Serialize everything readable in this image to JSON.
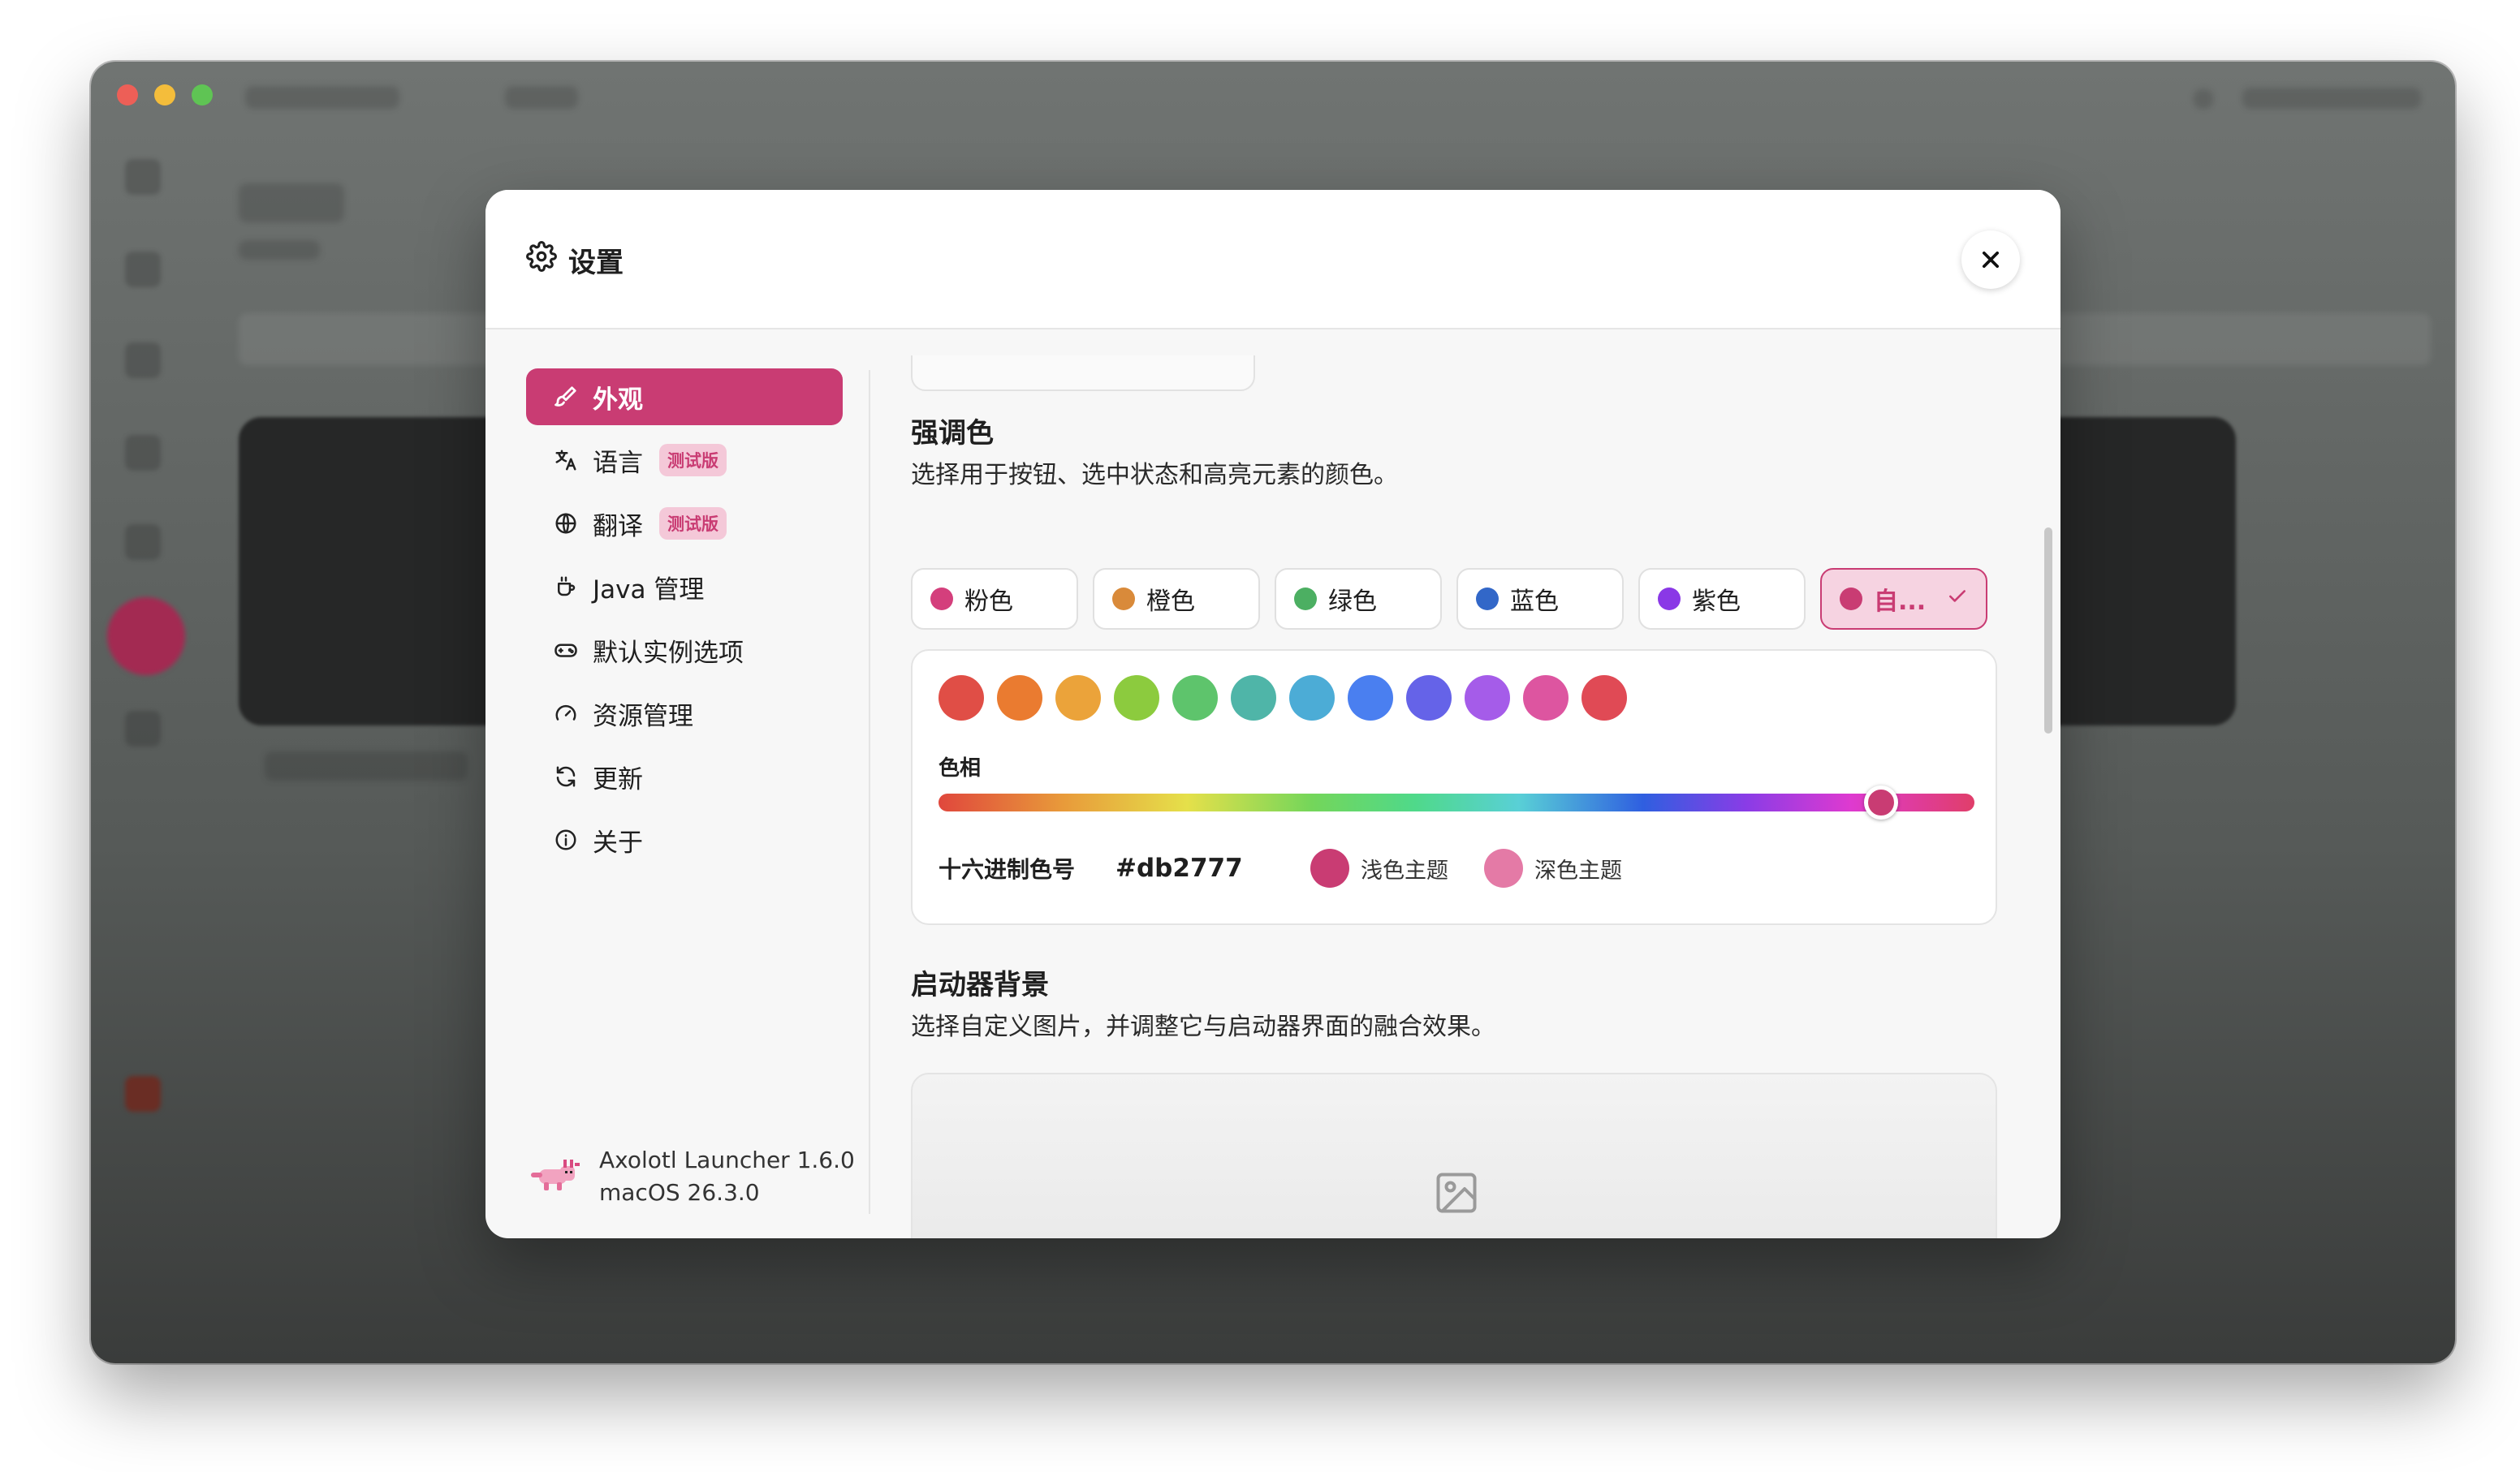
{
  "dialog": {
    "title": "设置",
    "close_label": "✕"
  },
  "nav": {
    "items": [
      {
        "label": "外观",
        "icon": "brush-icon",
        "active": true
      },
      {
        "label": "语言",
        "icon": "translate-icon",
        "badge": "测试版"
      },
      {
        "label": "翻译",
        "icon": "globe-icon",
        "badge": "测试版"
      },
      {
        "label": "Java 管理",
        "icon": "coffee-icon"
      },
      {
        "label": "默认实例选项",
        "icon": "gamepad-icon"
      },
      {
        "label": "资源管理",
        "icon": "gauge-icon"
      },
      {
        "label": "更新",
        "icon": "refresh-icon"
      },
      {
        "label": "关于",
        "icon": "info-icon"
      }
    ]
  },
  "version": {
    "app": "Axolotl Launcher 1.6.0",
    "os": "macOS 26.3.0",
    "logo_icon": "axolotl-logo-icon"
  },
  "accent": {
    "title": "强调色",
    "description": "选择用于按钮、选中状态和高亮元素的颜色。",
    "presets": [
      {
        "label": "粉色",
        "color": "#d43f7c"
      },
      {
        "label": "橙色",
        "color": "#d98a3a"
      },
      {
        "label": "绿色",
        "color": "#4caf62"
      },
      {
        "label": "蓝色",
        "color": "#3267c8"
      },
      {
        "label": "紫色",
        "color": "#8a38e6"
      },
      {
        "label": "自...",
        "color": "#c93c73",
        "selected": true
      }
    ],
    "swatches": [
      "#e04e46",
      "#ea7b30",
      "#eba33a",
      "#8ccb3e",
      "#5ec46c",
      "#4fb5a8",
      "#4cacd6",
      "#4a7ff0",
      "#6563e8",
      "#a55ce9",
      "#dd55a0",
      "#e04a55"
    ],
    "hue_label": "色相",
    "hue_value": 0.91,
    "hex_label": "十六进制色号",
    "hex_value": "#db2777",
    "light_theme": {
      "label": "浅色主题",
      "color": "#c93c73"
    },
    "dark_theme": {
      "label": "深色主题",
      "color": "#e47aa6"
    }
  },
  "background": {
    "title": "启动器背景",
    "description": "选择自定义图片，并调整它与启动器界面的融合效果。",
    "placeholder_icon": "image-icon"
  },
  "colors": {
    "accent": "#c93c73"
  }
}
